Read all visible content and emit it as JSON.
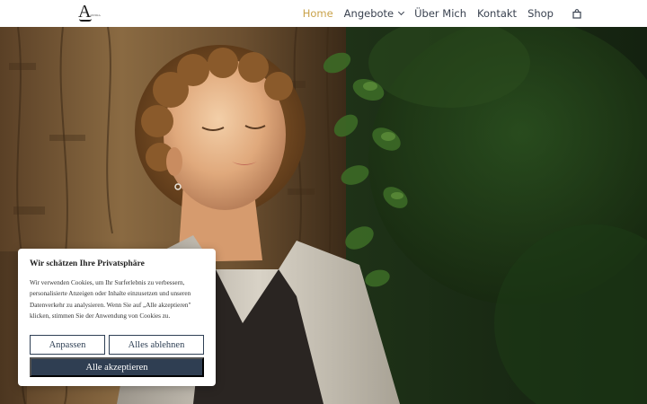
{
  "brand": {
    "logo_letter": "A",
    "logo_small_text": "ANNIKA"
  },
  "nav": {
    "items": [
      {
        "label": "Home",
        "active": true
      },
      {
        "label": "Angebote",
        "dropdown": true
      },
      {
        "label": "Über Mich"
      },
      {
        "label": "Kontakt"
      },
      {
        "label": "Shop"
      }
    ],
    "cart_icon": "shopping-bag-icon",
    "accent_color": "#c9a24a"
  },
  "hero": {
    "image_description_icon": "portrait-photo"
  },
  "cookie_banner": {
    "title": "Wir schätzen Ihre Privatsphäre",
    "text": "Wir verwenden Cookies, um Ihr Surferlebnis zu verbessern, personalisierte Anzeigen oder Inhalte einzusetzen und unseren Datenverkehr zu analysieren. Wenn Sie auf „Alle akzeptieren\" klicken, stimmen Sie der Anwendung von Cookies zu.",
    "customize_label": "Anpassen",
    "reject_label": "Alles ablehnen",
    "accept_label": "Alle akzeptieren",
    "primary_color": "#2f3e52"
  }
}
